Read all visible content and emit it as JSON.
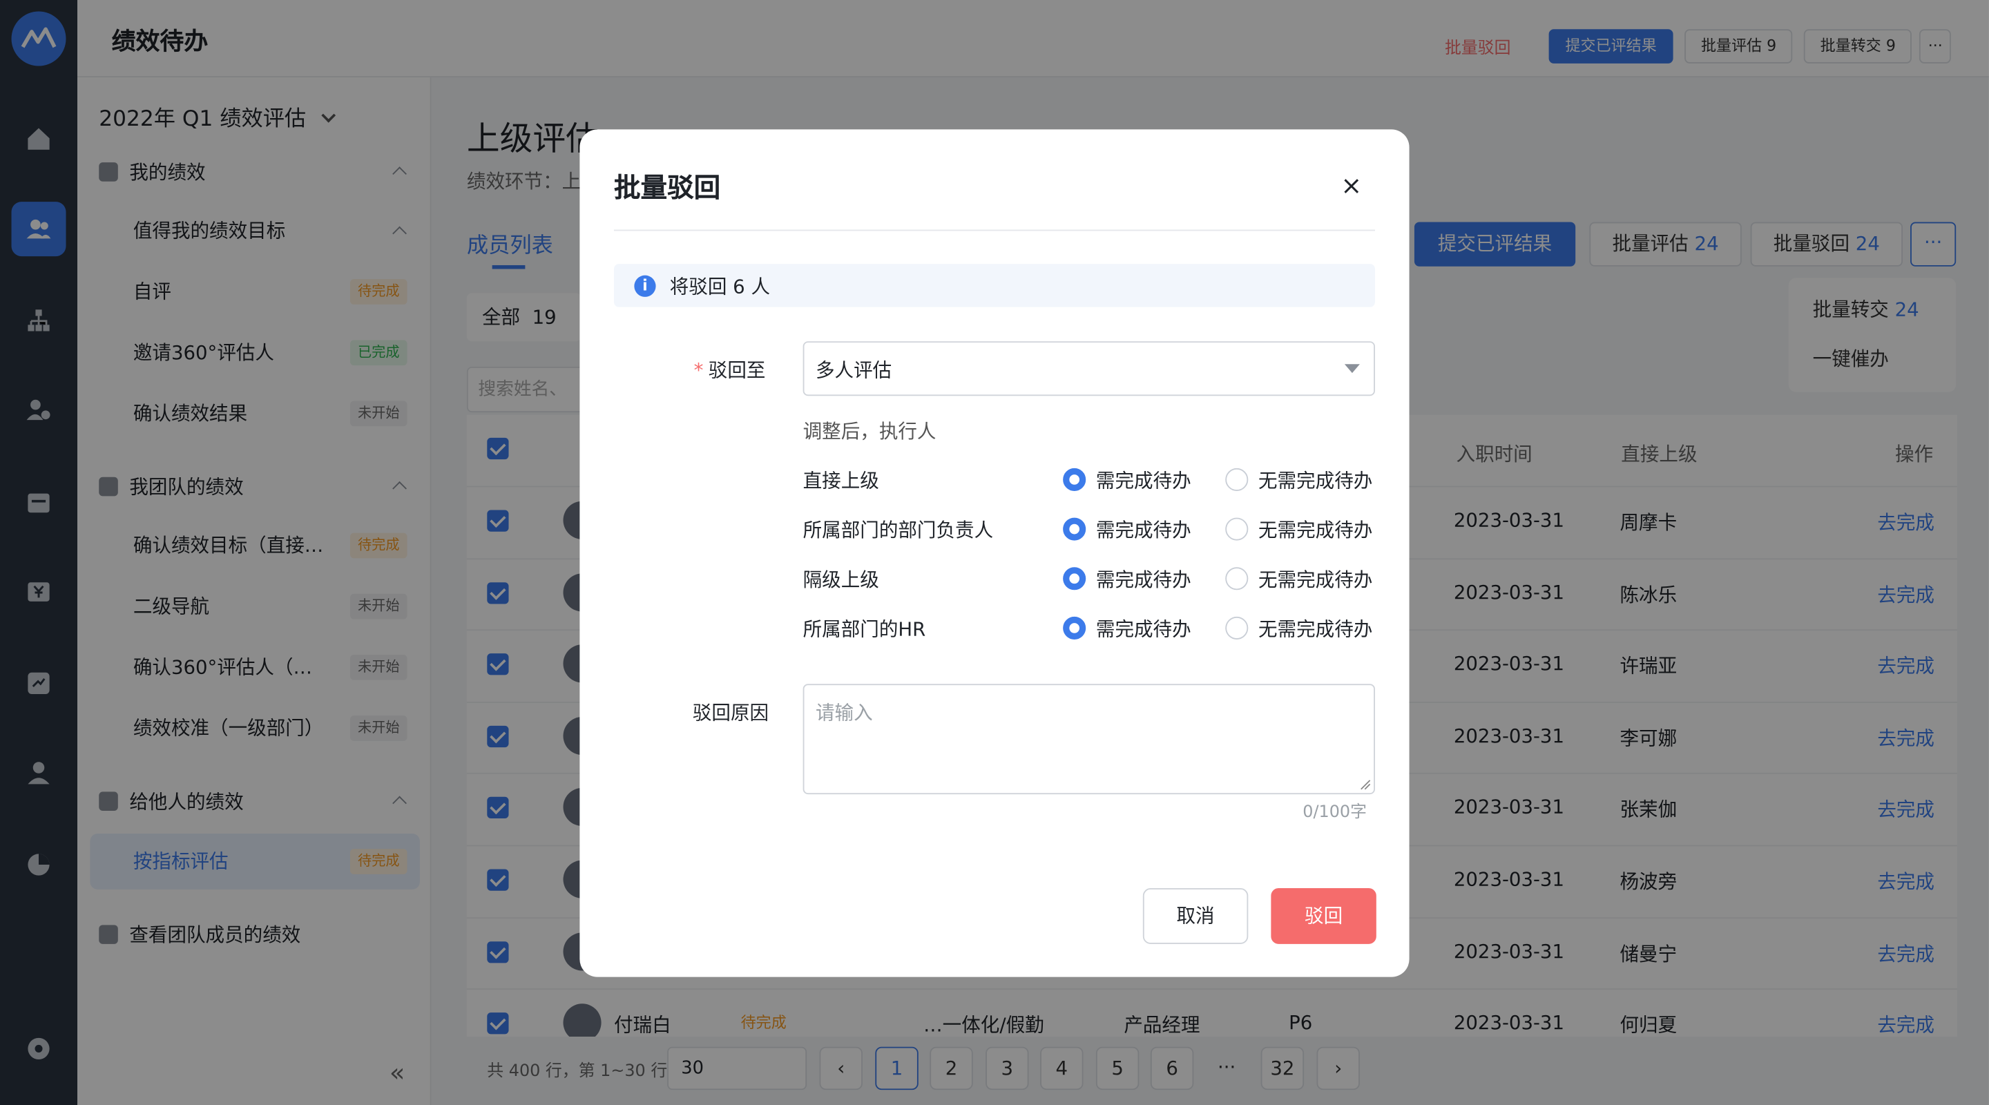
{
  "app": {
    "title": "绩效待办"
  },
  "topbar": {
    "batch_reject": "批量驳回",
    "submit_results": "提交已评结果",
    "batch_eval": "批量评估 9",
    "batch_transfer": "批量转交 9",
    "more": "···"
  },
  "sidebar": {
    "period": "2022年 Q1 绩效评估",
    "sections": [
      {
        "label": "我的绩效",
        "items": [
          {
            "label": "值得我的绩效目标",
            "tag": ""
          },
          {
            "label": "自评",
            "tag": "待完成"
          },
          {
            "label": "邀请360°评估人",
            "tag": "已完成"
          },
          {
            "label": "确认绩效结果",
            "tag": "未开始"
          }
        ]
      },
      {
        "label": "我团队的绩效",
        "items": [
          {
            "label": "确认绩效目标（直接…",
            "tag": "待完成"
          },
          {
            "label": "二级导航",
            "tag": "未开始"
          },
          {
            "label": "确认360°评估人（…",
            "tag": "未开始"
          },
          {
            "label": "绩效校准（一级部门）",
            "tag": "未开始"
          }
        ]
      },
      {
        "label": "给他人的绩效",
        "items": [
          {
            "label": "按指标评估",
            "tag": "待完成"
          }
        ]
      },
      {
        "label": "查看团队成员的绩效",
        "items": []
      }
    ],
    "collapse": "«"
  },
  "main": {
    "page_title": "上级评估",
    "stage": "绩效环节：上",
    "tab": "成员列表",
    "all_label": "全部",
    "all_count": "19",
    "search_placeholder": "搜索姓名、",
    "actions": {
      "submit": "提交已评结果",
      "eval": "批量评估",
      "eval_count": "24",
      "reject": "批量驳回",
      "reject_count": "24",
      "transfer": "批量转交",
      "transfer_count": "24",
      "urge": "一键催办"
    },
    "columns": {
      "join": "入职时间",
      "leader": "直接上级",
      "op": "操作"
    },
    "rows": [
      {
        "date": "2023-03-31",
        "leader": "周摩卡",
        "op": "去完成"
      },
      {
        "date": "2023-03-31",
        "leader": "陈冰乐",
        "op": "去完成"
      },
      {
        "date": "2023-03-31",
        "leader": "许瑞亚",
        "op": "去完成"
      },
      {
        "date": "2023-03-31",
        "leader": "李可娜",
        "op": "去完成"
      },
      {
        "date": "2023-03-31",
        "leader": "张茉伽",
        "op": "去完成"
      },
      {
        "date": "2023-03-31",
        "leader": "杨波旁",
        "op": "去完成"
      },
      {
        "date": "2023-03-31",
        "leader": "储曼宁",
        "op": "去完成"
      },
      {
        "date": "2023-03-31",
        "leader": "何归夏",
        "op": "去完成",
        "name": "付瑞白",
        "status": "待完成",
        "dept": "…一体化/假勤",
        "role": "产品经理",
        "level": "P6"
      }
    ],
    "pagination": {
      "total": "共 400 行，第 1~30 行",
      "size": "30",
      "pages": [
        "1",
        "2",
        "3",
        "4",
        "5",
        "6",
        "···",
        "32"
      ],
      "prev": "‹",
      "next": "›"
    }
  },
  "modal": {
    "title": "批量驳回",
    "close": "×",
    "info": "将驳回 6 人",
    "reject_to_label": "驳回至",
    "reject_to_value": "多人评估",
    "hint": "调整后，执行人",
    "options": [
      {
        "role": "直接上级",
        "yes": "需完成待办",
        "no": "无需完成待办",
        "selected": "yes"
      },
      {
        "role": "所属部门的部门负责人",
        "yes": "需完成待办",
        "no": "无需完成待办",
        "selected": "yes"
      },
      {
        "role": "隔级上级",
        "yes": "需完成待办",
        "no": "无需完成待办",
        "selected": "yes"
      },
      {
        "role": "所属部门的HR",
        "yes": "需完成待办",
        "no": "无需完成待办",
        "selected": "yes"
      }
    ],
    "reason_label": "驳回原因",
    "reason_placeholder": "请输入",
    "counter": "0/100字",
    "cancel": "取消",
    "confirm": "驳回"
  },
  "colors": {
    "primary": "#3c7bea",
    "danger": "#f56c6c",
    "rail": "#2b3441"
  }
}
